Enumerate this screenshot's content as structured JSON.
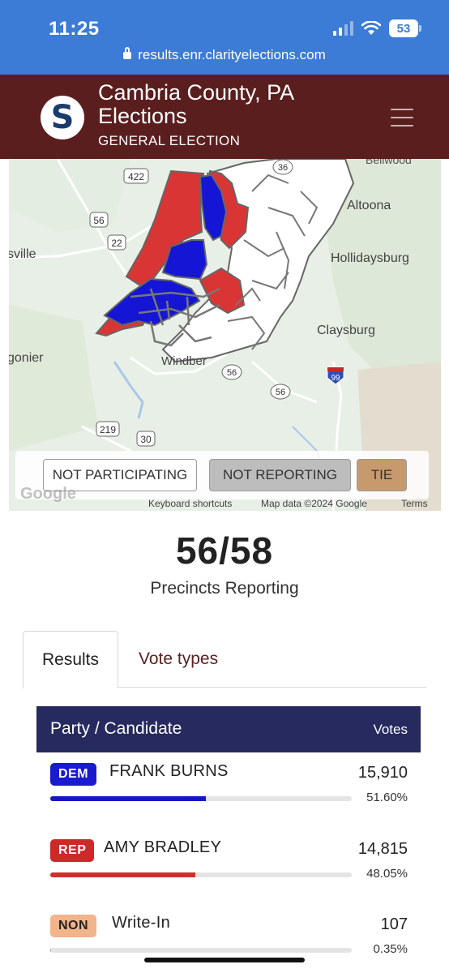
{
  "status_bar": {
    "time": "11:25",
    "battery": "53"
  },
  "browser": {
    "url": "results.enr.clarityelections.com"
  },
  "header": {
    "logo_glyph": "S",
    "title": "Cambria County, PA Elections",
    "subtitle": "GENERAL ELECTION"
  },
  "map": {
    "places": {
      "bellwood": "Bellwood",
      "altoona": "Altoona",
      "hollidaysburg": "Hollidaysburg",
      "claysburg": "Claysburg",
      "sville": "sville",
      "gonier": "gonier",
      "windber": "Windber"
    },
    "routes": {
      "r422": "422",
      "r56a": "56",
      "r22": "22",
      "r36": "36",
      "r56b": "56",
      "r56c": "56",
      "r99": "99",
      "r219": "219",
      "r30": "30"
    },
    "colors": {
      "dem": "#1515d6",
      "rep": "#d93535",
      "none": "#ffffff"
    },
    "legend": {
      "not_participating": "NOT PARTICIPATING",
      "not_reporting": "NOT REPORTING",
      "tie": "TIE"
    },
    "attribution": {
      "google": "Google",
      "shortcuts": "Keyboard shortcuts",
      "map_data": "Map data ©2024 Google",
      "terms": "Terms"
    }
  },
  "summary": {
    "precincts": "56/58",
    "precincts_label": "Precincts Reporting"
  },
  "tabs": {
    "results": "Results",
    "vote_types": "Vote types"
  },
  "table": {
    "header_candidate": "Party / Candidate",
    "header_votes": "Votes",
    "rows": [
      {
        "party": "DEM",
        "candidate": "FRANK BURNS",
        "votes": "15,910",
        "percent": "51.60%",
        "share": 0.516,
        "color": "#1616c4",
        "badge_bg": "#1a1ad0",
        "badge_fg": "#ffffff"
      },
      {
        "party": "REP",
        "candidate": "AMY BRADLEY",
        "votes": "14,815",
        "percent": "48.05%",
        "share": 0.4805,
        "color": "#d12e2e",
        "badge_bg": "#cc2a2a",
        "badge_fg": "#ffffff"
      },
      {
        "party": "NON",
        "candidate": "Write-In",
        "votes": "107",
        "percent": "0.35%",
        "share": 0.0035,
        "color": "#999999",
        "badge_bg": "#f2b48a",
        "badge_fg": "#222222"
      }
    ]
  }
}
